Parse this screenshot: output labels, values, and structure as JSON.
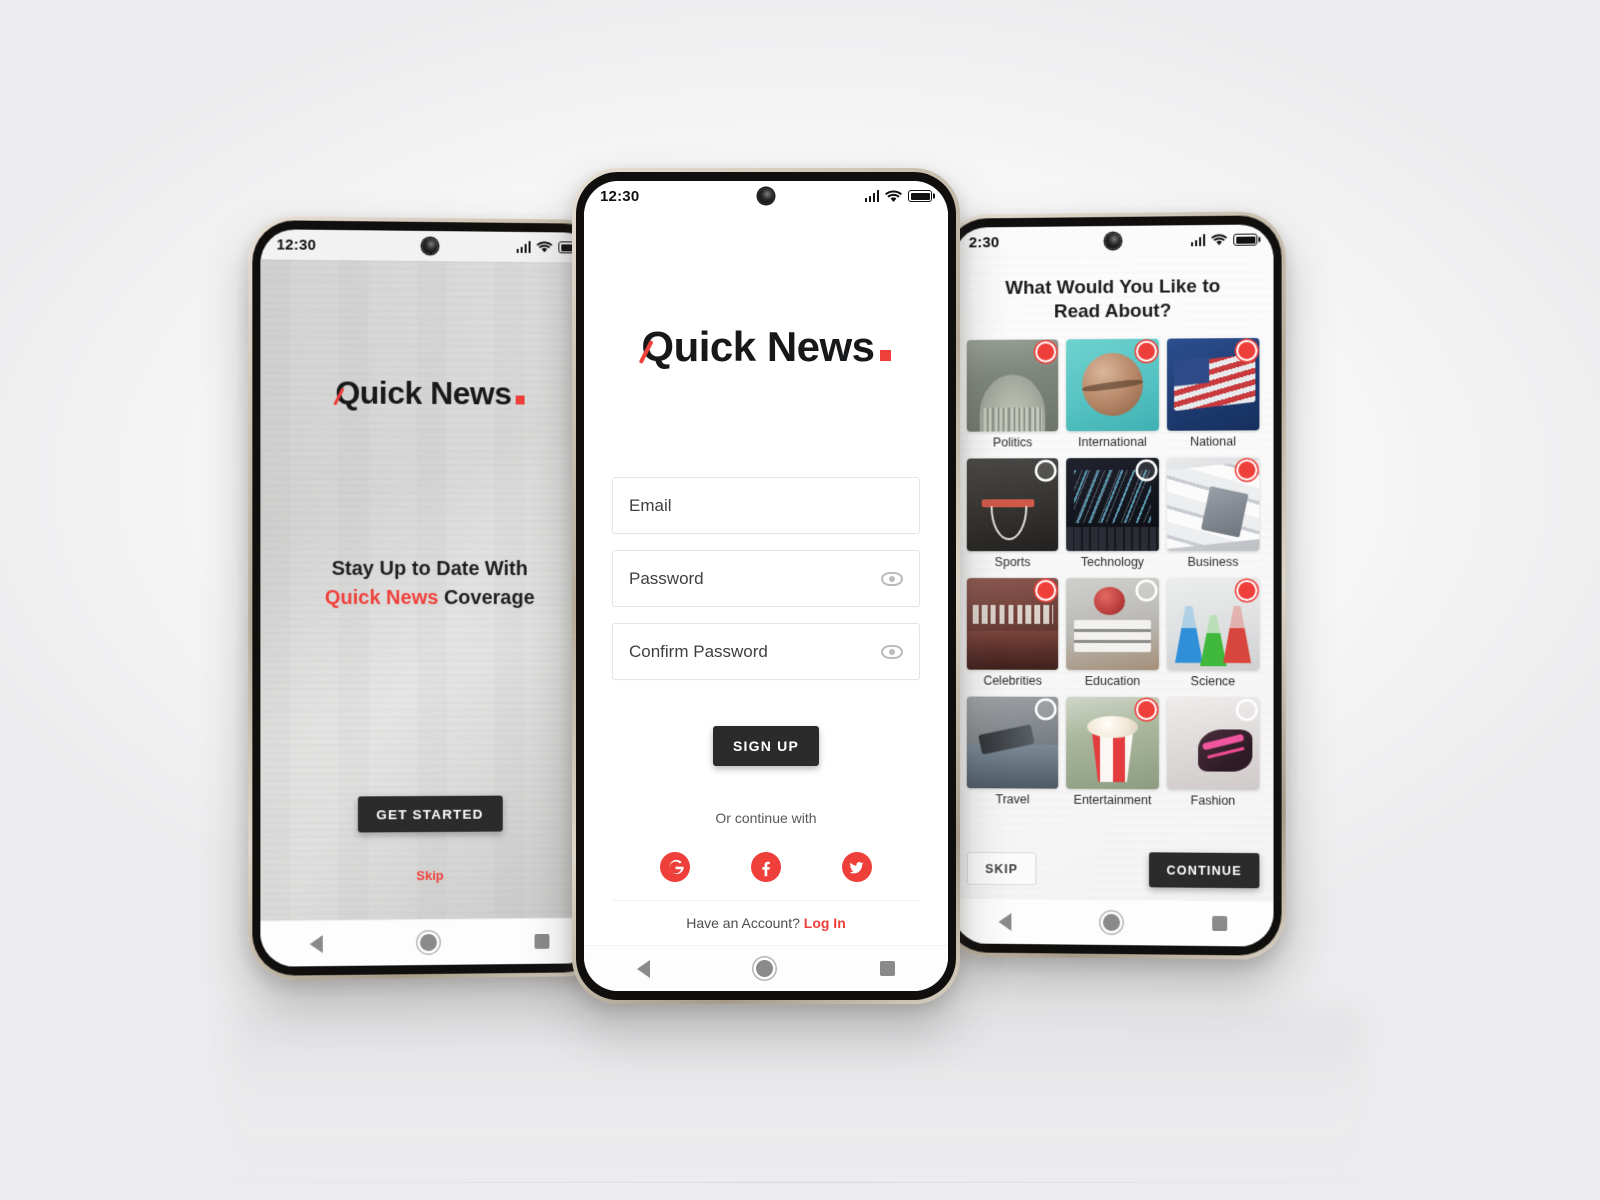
{
  "brand": {
    "name_part1": "Q",
    "name_part2": "uick",
    "name_part3": "News",
    "accent_color": "#ef3f3a",
    "dark_color": "#2b2b2b"
  },
  "status_bar": {
    "time": "12:30",
    "time_truncated": "2:30",
    "signal_icon": "signal-bars-icon",
    "wifi_icon": "wifi-icon",
    "battery_icon": "battery-icon",
    "camera_icon": "front-camera-punchhole"
  },
  "nav_bar": {
    "back": "back-triangle-icon",
    "home": "home-circle-icon",
    "recents": "recents-square-icon"
  },
  "onboarding_screen": {
    "tagline_line1": "Stay Up to Date With",
    "tagline_accent": "Quick News",
    "tagline_tail": " Coverage",
    "get_started_label": "GET STARTED",
    "skip_label": "Skip"
  },
  "signup_screen": {
    "fields": [
      {
        "placeholder": "Email",
        "has_eye": false,
        "name": "email-field"
      },
      {
        "placeholder": "Password",
        "has_eye": true,
        "name": "password-field"
      },
      {
        "placeholder": "Confirm Password",
        "has_eye": true,
        "name": "confirm-password-field"
      }
    ],
    "signup_label": "SIGN UP",
    "or_continue_with": "Or continue with",
    "socials": [
      {
        "name": "google-icon",
        "label": "Google"
      },
      {
        "name": "facebook-icon",
        "label": "Facebook"
      },
      {
        "name": "twitter-icon",
        "label": "Twitter"
      }
    ],
    "account_prompt": "Have an Account? ",
    "login_label": "Log In"
  },
  "categories_screen": {
    "title_line1": "What Would You Like to",
    "title_line2": "Read About?",
    "skip_label": "SKIP",
    "continue_label": "CONTINUE",
    "categories": [
      {
        "label": "Politics",
        "selected": true,
        "art": "th-politics"
      },
      {
        "label": "International",
        "selected": true,
        "art": "th-international"
      },
      {
        "label": "National",
        "selected": true,
        "art": "th-national"
      },
      {
        "label": "Sports",
        "selected": false,
        "art": "th-sports"
      },
      {
        "label": "Technology",
        "selected": false,
        "art": "th-technology"
      },
      {
        "label": "Business",
        "selected": true,
        "art": "th-business"
      },
      {
        "label": "Celebrities",
        "selected": true,
        "art": "th-celebrities"
      },
      {
        "label": "Education",
        "selected": false,
        "art": "th-education"
      },
      {
        "label": "Science",
        "selected": true,
        "art": "th-science"
      },
      {
        "label": "Travel",
        "selected": false,
        "art": "th-travel"
      },
      {
        "label": "Entertainment",
        "selected": true,
        "art": "th-entertainment"
      },
      {
        "label": "Fashion",
        "selected": false,
        "art": "th-fashion"
      }
    ]
  }
}
